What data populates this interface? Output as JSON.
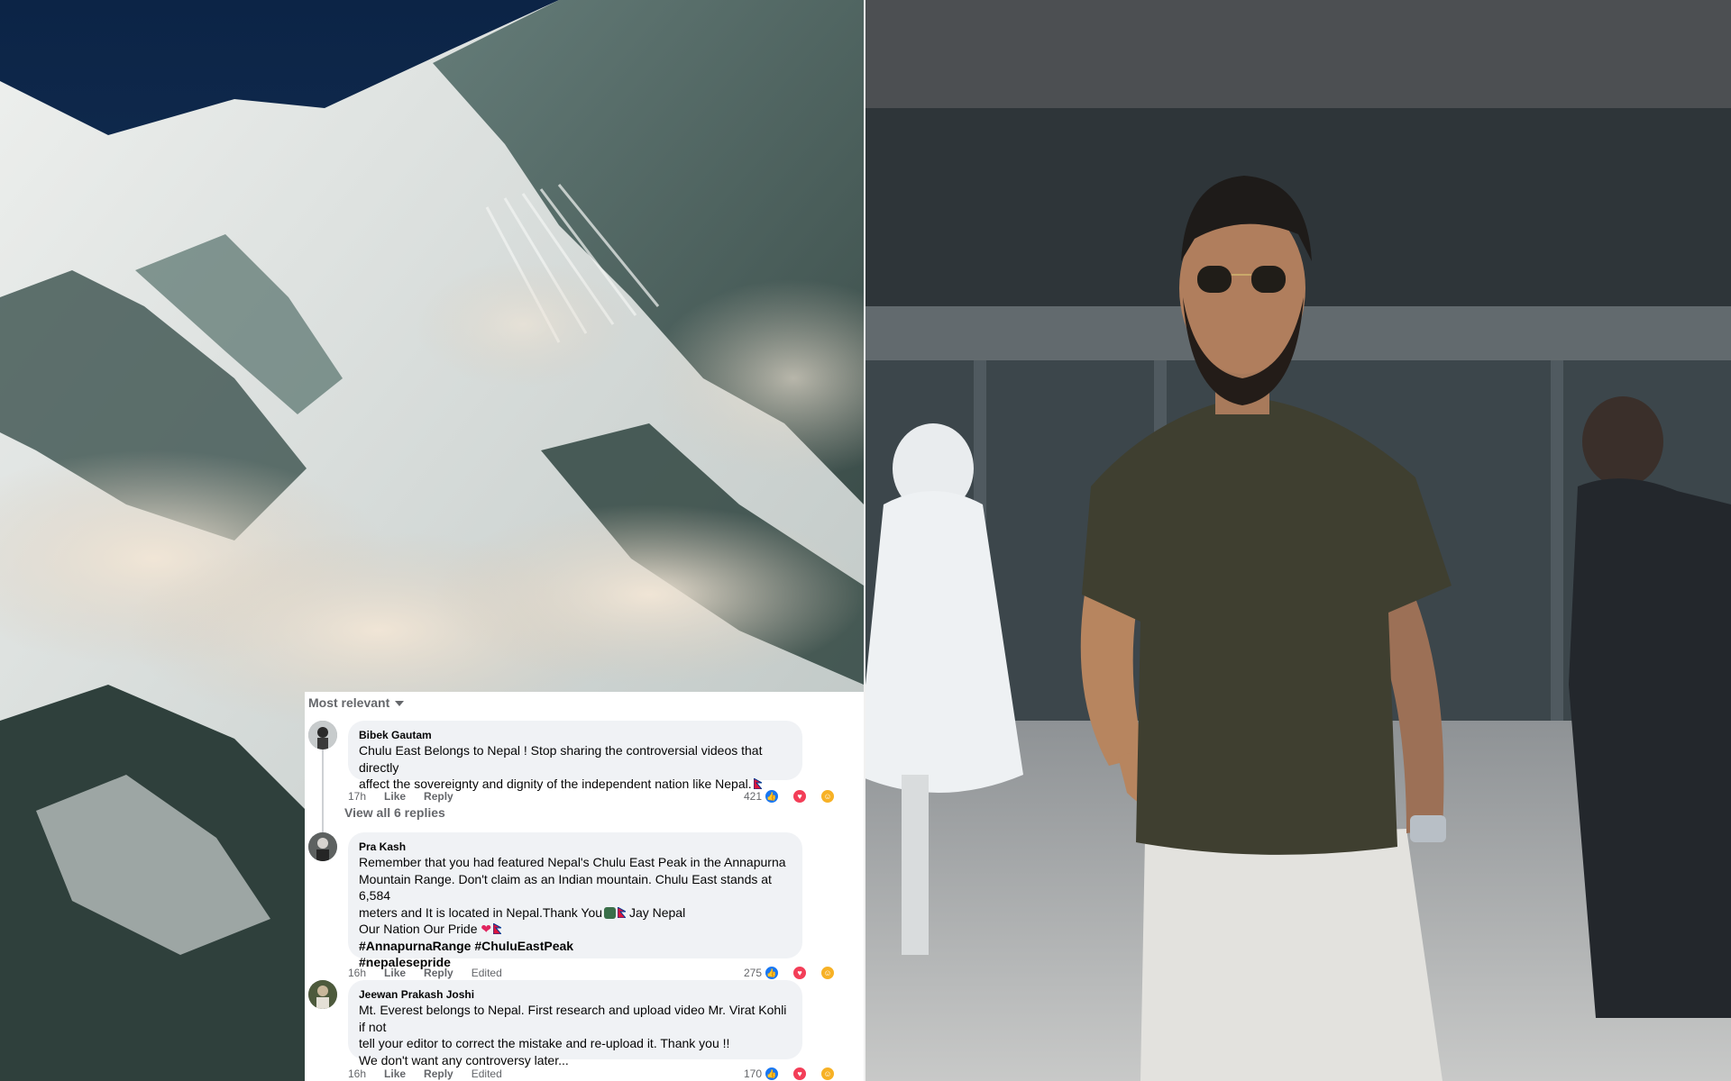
{
  "comments_panel": {
    "sort_label": "Most relevant",
    "comments": [
      {
        "author": "Bibek Gautam",
        "lines": [
          "Chulu East Belongs to Nepal ! Stop sharing the controversial videos that directly",
          "affect the sovereignty and dignity of the independent nation like Nepal."
        ],
        "time": "17h",
        "like_label": "Like",
        "reply_label": "Reply",
        "reaction_count": "421",
        "view_replies": "View all 6 replies"
      },
      {
        "author": "Pra Kash",
        "lines": [
          "Remember that you had featured Nepal's Chulu East Peak in the Annapurna",
          "Mountain Range. Don't claim as an Indian mountain. Chulu East stands at 6,584",
          "meters and It is located in Nepal.Thank You",
          "Jay Nepal",
          "Our Nation Our Pride"
        ],
        "hashtags": [
          "#AnnapurnaRange #ChuluEastPeak",
          "#nepalesepride"
        ],
        "time": "16h",
        "like_label": "Like",
        "reply_label": "Reply",
        "edited_label": "Edited",
        "reaction_count": "275"
      },
      {
        "author": "Jeewan Prakash Joshi",
        "lines": [
          "Mt. Everest belongs to Nepal. First research and upload video Mr. Virat Kohli if not",
          "tell your editor to correct the mistake and re-upload it. Thank you !!",
          "We don't want any controversy later..."
        ],
        "time": "16h",
        "like_label": "Like",
        "reply_label": "Reply",
        "edited_label": "Edited",
        "reaction_count": "170"
      }
    ]
  },
  "colors": {
    "panel_bg": "#ffffff",
    "bubble_bg": "#f0f2f5",
    "meta_text": "#65676b",
    "like_blue": "#1877f2",
    "love_red": "#f33e58",
    "haha_yellow": "#f7b125"
  },
  "icons": [
    "like-reaction-icon",
    "love-reaction-icon",
    "haha-reaction-icon",
    "nepal-flag-icon",
    "heart-emoji-icon",
    "globe-emoji-icon"
  ]
}
